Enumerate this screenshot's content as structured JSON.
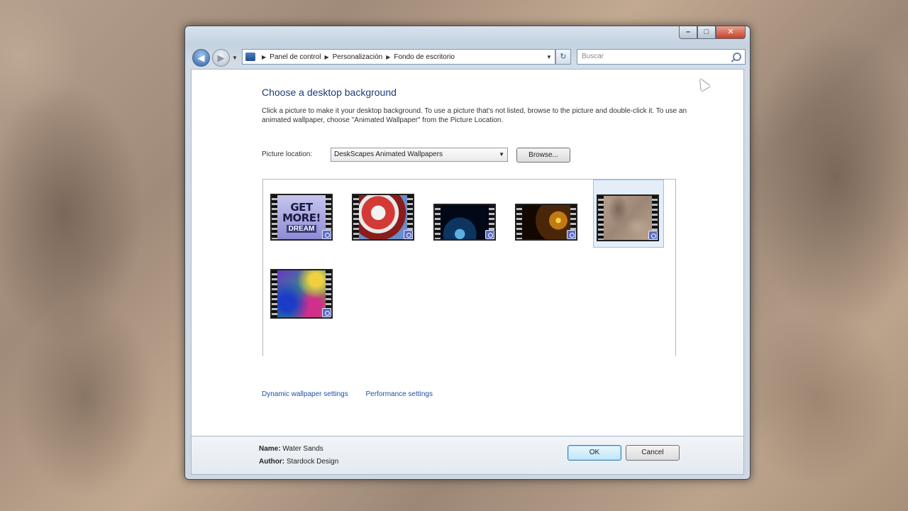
{
  "navigation": {
    "breadcrumbs": [
      "Panel de control",
      "Personalización",
      "Fondo de escritorio"
    ],
    "search_placeholder": "Buscar"
  },
  "page": {
    "title": "Choose a desktop background",
    "description": "Click a picture to make it your desktop background. To use a picture that's not listed, browse to the picture and double-click it. To use an animated wallpaper, choose \"Animated Wallpaper\" from the Picture Location.",
    "picture_location_label": "Picture location:",
    "picture_location_value": "DeskScapes Animated Wallpapers",
    "browse_label": "Browse..."
  },
  "thumbnails": [
    {
      "name": "get-more",
      "text": "GET MORE!",
      "subtext": "DREAM"
    },
    {
      "name": "red-cube"
    },
    {
      "name": "earth"
    },
    {
      "name": "fire"
    },
    {
      "name": "sand",
      "selected": true
    },
    {
      "name": "colors"
    }
  ],
  "links": {
    "dynamic": "Dynamic wallpaper settings",
    "performance": "Performance settings"
  },
  "footer": {
    "name_label": "Name:",
    "name_value": "Water Sands",
    "author_label": "Author:",
    "author_value": "Stardock Design",
    "ok_label": "OK",
    "cancel_label": "Cancel"
  },
  "icons": {
    "back": "back-arrow-icon",
    "forward": "forward-arrow-icon",
    "refresh": "refresh-icon",
    "search": "search-icon",
    "minimize": "minimize-icon",
    "maximize": "maximize-icon",
    "close": "close-icon"
  },
  "colors": {
    "title_blue": "#1e3b78",
    "link_blue": "#1e4fa8",
    "close_red": "#c4412a"
  }
}
